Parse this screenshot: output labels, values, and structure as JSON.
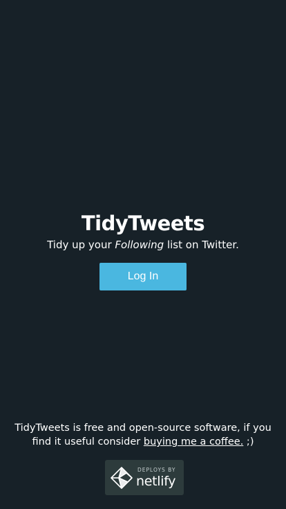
{
  "hero": {
    "title": "TidyTweets",
    "tagline_before": "Tidy up your ",
    "tagline_emphasis": "Following",
    "tagline_after": " list on Twitter.",
    "login_label": "Log In"
  },
  "footer": {
    "text_before": "TidyTweets is free and open-source software, if you find it useful consider ",
    "link_label": "buying me a coffee.",
    "text_after": " ;)"
  },
  "badge": {
    "caption": "DEPLOYS BY",
    "brand": "netlify",
    "icon": "netlify-logo-icon"
  },
  "colors": {
    "background": "#172128",
    "button": "#4ab7e0",
    "badge_background": "#2d3b3c"
  }
}
